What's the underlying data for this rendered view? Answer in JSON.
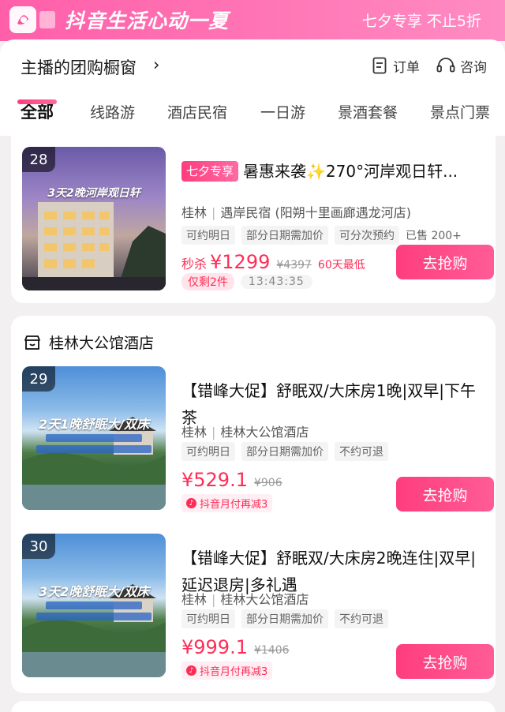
{
  "banner": {
    "title": "抖音生活心动一夏",
    "promo": "七夕专享 不止5折",
    "logo_icon": "douyin-life-logo"
  },
  "header": {
    "shop_title": "主播的团购橱窗",
    "chevron": "›",
    "orders_label": "订单",
    "consult_label": "咨询"
  },
  "tabs": [
    {
      "label": "全部",
      "active": true
    },
    {
      "label": "线路游"
    },
    {
      "label": "酒店民宿"
    },
    {
      "label": "一日游"
    },
    {
      "label": "景酒套餐"
    },
    {
      "label": "景点门票"
    }
  ],
  "products": [
    {
      "rank": "28",
      "thumb_text": "3天2晚河岸观日轩",
      "tag": "七夕专享",
      "title": "暑惠来袭✨270°河岸观日轩...",
      "city": "桂林",
      "venue": "遇岸民宿 (阳朔十里画廊遇龙河店)",
      "chips": [
        "可约明日",
        "部分日期需加价",
        "可分次预约",
        "已售 200+"
      ],
      "price_prefix": "秒杀",
      "price": "¥1299",
      "original_price": "¥4397",
      "lowest_note": "60天最低",
      "stock": "仅剩2件",
      "countdown": "13:43:35",
      "buy_label": "去抢购"
    },
    {
      "rank": "29",
      "thumb_text": "2天1晚舒眠大/双床",
      "title": "【错峰大促】舒眠双/大床房1晚|双早|下午茶",
      "city": "桂林",
      "venue": "桂林大公馆酒店",
      "chips": [
        "可约明日",
        "部分日期需加价",
        "不约可退"
      ],
      "price": "¥529.1",
      "original_price": "¥906",
      "pay_discount": "抖音月付再减3",
      "buy_label": "去抢购"
    },
    {
      "rank": "30",
      "thumb_text": "3天2晚舒眠大/双床",
      "title": "【错峰大促】舒眠双/大床房2晚连住|双早|延迟退房|多礼遇",
      "city": "桂林",
      "venue": "桂林大公馆酒店",
      "chips": [
        "可约明日",
        "部分日期需加价",
        "不约可退"
      ],
      "price": "¥999.1",
      "original_price": "¥1406",
      "pay_discount": "抖音月付再减3",
      "buy_label": "去抢购"
    }
  ],
  "store": {
    "name": "桂林大公馆酒店",
    "icon": "store-icon"
  },
  "colors": {
    "accent": "#ff2d55",
    "banner": "#ff6fb1",
    "button": "#ff3d7e"
  }
}
